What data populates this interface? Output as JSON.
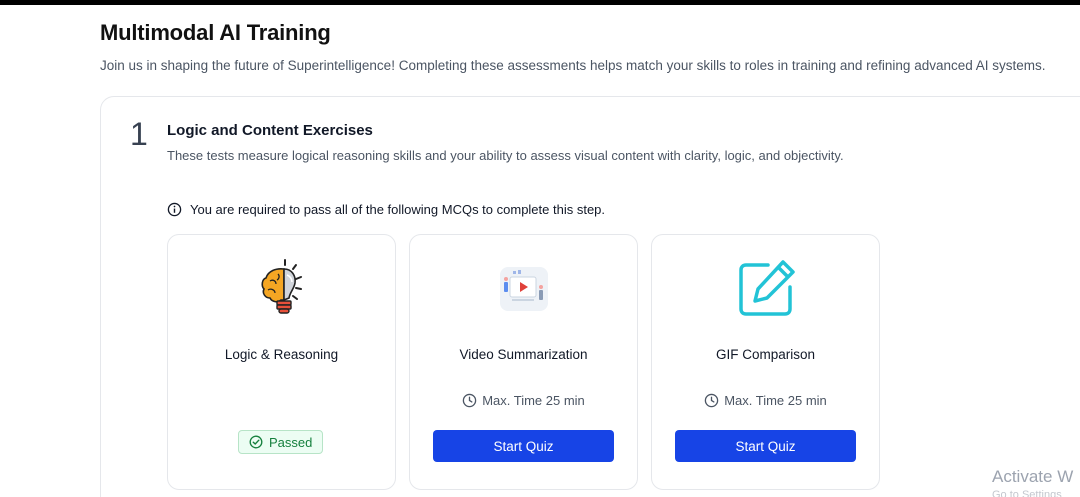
{
  "header": {
    "title": "Multimodal AI Training",
    "subtitle": "Join us in shaping the future of Superintelligence! Completing these assessments helps match your skills to roles in training and refining advanced AI systems."
  },
  "step": {
    "number": "1",
    "title": "Logic and Content Exercises",
    "description": "These tests measure logical reasoning skills and your ability to assess visual content with clarity, logic, and objectivity.",
    "notice": "You are required to pass all of the following MCQs to complete this step."
  },
  "quizzes": [
    {
      "name": "Logic & Reasoning",
      "icon": "lightbulb-brain-icon",
      "status": "Passed"
    },
    {
      "name": "Video Summarization",
      "icon": "video-presentation-icon",
      "time": "Max. Time 25 min",
      "button": "Start Quiz"
    },
    {
      "name": "GIF Comparison",
      "icon": "edit-pencil-icon",
      "time": "Max. Time 25 min",
      "button": "Start Quiz"
    }
  ],
  "watermark": {
    "line1": "Activate W",
    "line2": "Go to Settings"
  },
  "colors": {
    "primary_button": "#1744e6",
    "passed_green": "#15803d",
    "edit_icon_teal": "#22c3d6"
  }
}
